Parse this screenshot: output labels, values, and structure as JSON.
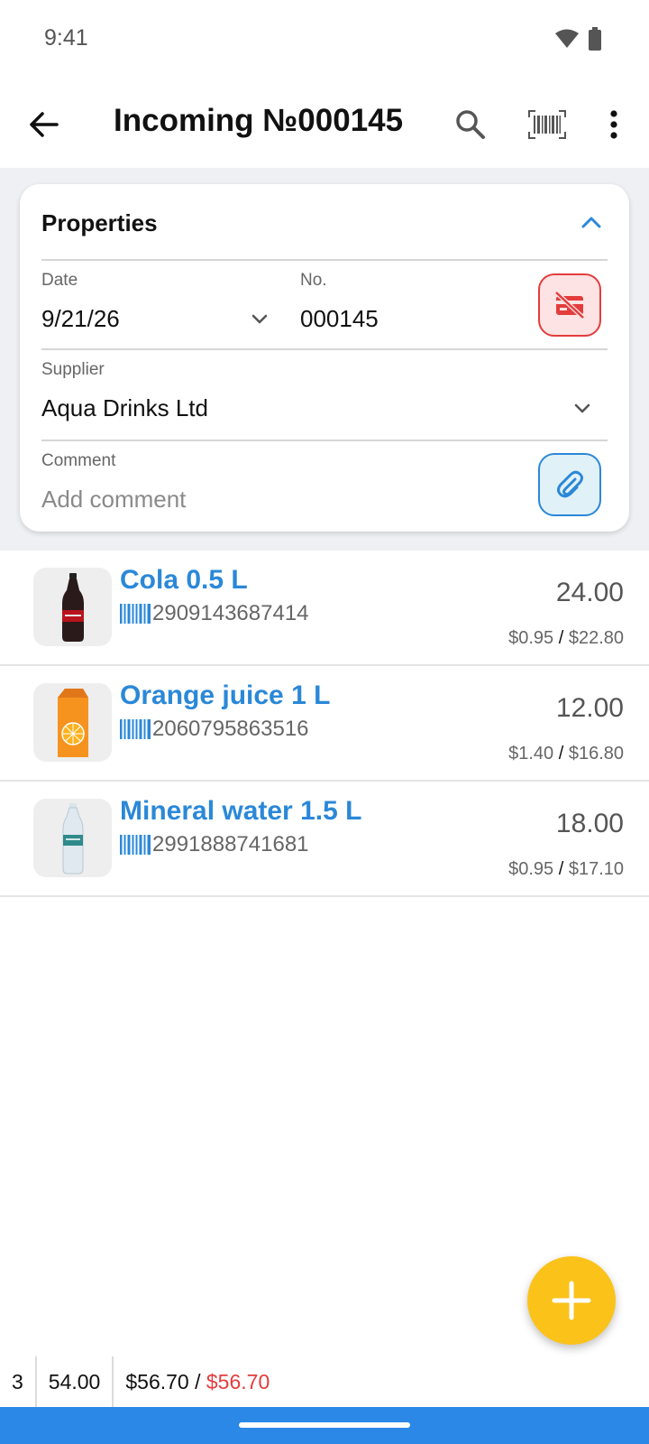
{
  "status_bar": {
    "time": "9:41"
  },
  "toolbar": {
    "title": "Incoming №000145",
    "icons": [
      "back-arrow-icon",
      "search-icon",
      "barcode-scan-icon",
      "more-vert-icon"
    ]
  },
  "properties": {
    "title": "Properties",
    "date_label": "Date",
    "date_value": "9/21/26",
    "number_label": "No.",
    "number_value": "000145",
    "supplier_label": "Supplier",
    "supplier_value": "Aqua Drinks Ltd",
    "comment_label": "Comment",
    "comment_placeholder": "Add comment"
  },
  "items": [
    {
      "name": "Cola 0.5 L",
      "barcode": "2909143687414",
      "qty": "24.00",
      "unit_price": "$0.95",
      "sep": "/",
      "total": "$22.80",
      "image": "cola-bottle"
    },
    {
      "name": "Orange juice 1 L",
      "barcode": "2060795863516",
      "qty": "12.00",
      "unit_price": "$1.40",
      "sep": "/",
      "total": "$16.80",
      "image": "orange-juice-carton"
    },
    {
      "name": "Mineral water 1.5 L",
      "barcode": "2991888741681",
      "qty": "18.00",
      "unit_price": "$0.95",
      "sep": "/",
      "total": "$17.10",
      "image": "water-bottle"
    }
  ],
  "totals": {
    "count": "3",
    "qty": "54.00",
    "amount": "$56.70",
    "sep": "/",
    "amount_red": "$56.70"
  },
  "colors": {
    "accent": "#2b88d8",
    "fab": "#fbc21a",
    "danger": "#e43c3c",
    "navbar": "#2b88e6"
  }
}
